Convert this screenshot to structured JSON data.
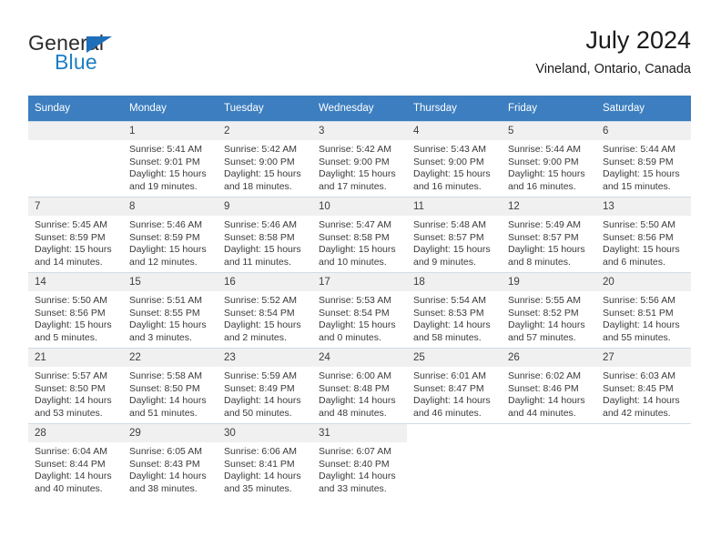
{
  "logo": {
    "word_one": "General",
    "word_two": "Blue",
    "triangle_icon": "triangle-icon",
    "accent_dark": "#2b2b2b",
    "accent_blue": "#1b7fc4"
  },
  "header": {
    "title": "July 2024",
    "subtitle": "Vineland, Ontario, Canada"
  },
  "theme": {
    "header_bg": "#3c7ebf",
    "header_text": "#ffffff",
    "daynum_bg": "#f0f0f0",
    "cell_text": "#3a3a3a",
    "grid_line": "#b9cde0"
  },
  "weekday_headers": [
    "Sunday",
    "Monday",
    "Tuesday",
    "Wednesday",
    "Thursday",
    "Friday",
    "Saturday"
  ],
  "labels": {
    "sunrise_prefix": "Sunrise:",
    "sunset_prefix": "Sunset:",
    "daylight_prefix": "Daylight:"
  },
  "weeks": [
    [
      {
        "day": "",
        "blank": true,
        "line1": "",
        "line2": "",
        "line3": "",
        "line4": ""
      },
      {
        "day": "1",
        "line1": "Sunrise: 5:41 AM",
        "line2": "Sunset: 9:01 PM",
        "line3": "Daylight: 15 hours",
        "line4": "and 19 minutes."
      },
      {
        "day": "2",
        "line1": "Sunrise: 5:42 AM",
        "line2": "Sunset: 9:00 PM",
        "line3": "Daylight: 15 hours",
        "line4": "and 18 minutes."
      },
      {
        "day": "3",
        "line1": "Sunrise: 5:42 AM",
        "line2": "Sunset: 9:00 PM",
        "line3": "Daylight: 15 hours",
        "line4": "and 17 minutes."
      },
      {
        "day": "4",
        "line1": "Sunrise: 5:43 AM",
        "line2": "Sunset: 9:00 PM",
        "line3": "Daylight: 15 hours",
        "line4": "and 16 minutes."
      },
      {
        "day": "5",
        "line1": "Sunrise: 5:44 AM",
        "line2": "Sunset: 9:00 PM",
        "line3": "Daylight: 15 hours",
        "line4": "and 16 minutes."
      },
      {
        "day": "6",
        "line1": "Sunrise: 5:44 AM",
        "line2": "Sunset: 8:59 PM",
        "line3": "Daylight: 15 hours",
        "line4": "and 15 minutes."
      }
    ],
    [
      {
        "day": "7",
        "line1": "Sunrise: 5:45 AM",
        "line2": "Sunset: 8:59 PM",
        "line3": "Daylight: 15 hours",
        "line4": "and 14 minutes."
      },
      {
        "day": "8",
        "line1": "Sunrise: 5:46 AM",
        "line2": "Sunset: 8:59 PM",
        "line3": "Daylight: 15 hours",
        "line4": "and 12 minutes."
      },
      {
        "day": "9",
        "line1": "Sunrise: 5:46 AM",
        "line2": "Sunset: 8:58 PM",
        "line3": "Daylight: 15 hours",
        "line4": "and 11 minutes."
      },
      {
        "day": "10",
        "line1": "Sunrise: 5:47 AM",
        "line2": "Sunset: 8:58 PM",
        "line3": "Daylight: 15 hours",
        "line4": "and 10 minutes."
      },
      {
        "day": "11",
        "line1": "Sunrise: 5:48 AM",
        "line2": "Sunset: 8:57 PM",
        "line3": "Daylight: 15 hours",
        "line4": "and 9 minutes."
      },
      {
        "day": "12",
        "line1": "Sunrise: 5:49 AM",
        "line2": "Sunset: 8:57 PM",
        "line3": "Daylight: 15 hours",
        "line4": "and 8 minutes."
      },
      {
        "day": "13",
        "line1": "Sunrise: 5:50 AM",
        "line2": "Sunset: 8:56 PM",
        "line3": "Daylight: 15 hours",
        "line4": "and 6 minutes."
      }
    ],
    [
      {
        "day": "14",
        "line1": "Sunrise: 5:50 AM",
        "line2": "Sunset: 8:56 PM",
        "line3": "Daylight: 15 hours",
        "line4": "and 5 minutes."
      },
      {
        "day": "15",
        "line1": "Sunrise: 5:51 AM",
        "line2": "Sunset: 8:55 PM",
        "line3": "Daylight: 15 hours",
        "line4": "and 3 minutes."
      },
      {
        "day": "16",
        "line1": "Sunrise: 5:52 AM",
        "line2": "Sunset: 8:54 PM",
        "line3": "Daylight: 15 hours",
        "line4": "and 2 minutes."
      },
      {
        "day": "17",
        "line1": "Sunrise: 5:53 AM",
        "line2": "Sunset: 8:54 PM",
        "line3": "Daylight: 15 hours",
        "line4": "and 0 minutes."
      },
      {
        "day": "18",
        "line1": "Sunrise: 5:54 AM",
        "line2": "Sunset: 8:53 PM",
        "line3": "Daylight: 14 hours",
        "line4": "and 58 minutes."
      },
      {
        "day": "19",
        "line1": "Sunrise: 5:55 AM",
        "line2": "Sunset: 8:52 PM",
        "line3": "Daylight: 14 hours",
        "line4": "and 57 minutes."
      },
      {
        "day": "20",
        "line1": "Sunrise: 5:56 AM",
        "line2": "Sunset: 8:51 PM",
        "line3": "Daylight: 14 hours",
        "line4": "and 55 minutes."
      }
    ],
    [
      {
        "day": "21",
        "line1": "Sunrise: 5:57 AM",
        "line2": "Sunset: 8:50 PM",
        "line3": "Daylight: 14 hours",
        "line4": "and 53 minutes."
      },
      {
        "day": "22",
        "line1": "Sunrise: 5:58 AM",
        "line2": "Sunset: 8:50 PM",
        "line3": "Daylight: 14 hours",
        "line4": "and 51 minutes."
      },
      {
        "day": "23",
        "line1": "Sunrise: 5:59 AM",
        "line2": "Sunset: 8:49 PM",
        "line3": "Daylight: 14 hours",
        "line4": "and 50 minutes."
      },
      {
        "day": "24",
        "line1": "Sunrise: 6:00 AM",
        "line2": "Sunset: 8:48 PM",
        "line3": "Daylight: 14 hours",
        "line4": "and 48 minutes."
      },
      {
        "day": "25",
        "line1": "Sunrise: 6:01 AM",
        "line2": "Sunset: 8:47 PM",
        "line3": "Daylight: 14 hours",
        "line4": "and 46 minutes."
      },
      {
        "day": "26",
        "line1": "Sunrise: 6:02 AM",
        "line2": "Sunset: 8:46 PM",
        "line3": "Daylight: 14 hours",
        "line4": "and 44 minutes."
      },
      {
        "day": "27",
        "line1": "Sunrise: 6:03 AM",
        "line2": "Sunset: 8:45 PM",
        "line3": "Daylight: 14 hours",
        "line4": "and 42 minutes."
      }
    ],
    [
      {
        "day": "28",
        "line1": "Sunrise: 6:04 AM",
        "line2": "Sunset: 8:44 PM",
        "line3": "Daylight: 14 hours",
        "line4": "and 40 minutes."
      },
      {
        "day": "29",
        "line1": "Sunrise: 6:05 AM",
        "line2": "Sunset: 8:43 PM",
        "line3": "Daylight: 14 hours",
        "line4": "and 38 minutes."
      },
      {
        "day": "30",
        "line1": "Sunrise: 6:06 AM",
        "line2": "Sunset: 8:41 PM",
        "line3": "Daylight: 14 hours",
        "line4": "and 35 minutes."
      },
      {
        "day": "31",
        "line1": "Sunrise: 6:07 AM",
        "line2": "Sunset: 8:40 PM",
        "line3": "Daylight: 14 hours",
        "line4": "and 33 minutes."
      },
      {
        "day": "",
        "empty": true,
        "line1": "",
        "line2": "",
        "line3": "",
        "line4": ""
      },
      {
        "day": "",
        "empty": true,
        "line1": "",
        "line2": "",
        "line3": "",
        "line4": ""
      },
      {
        "day": "",
        "empty": true,
        "line1": "",
        "line2": "",
        "line3": "",
        "line4": ""
      }
    ]
  ]
}
